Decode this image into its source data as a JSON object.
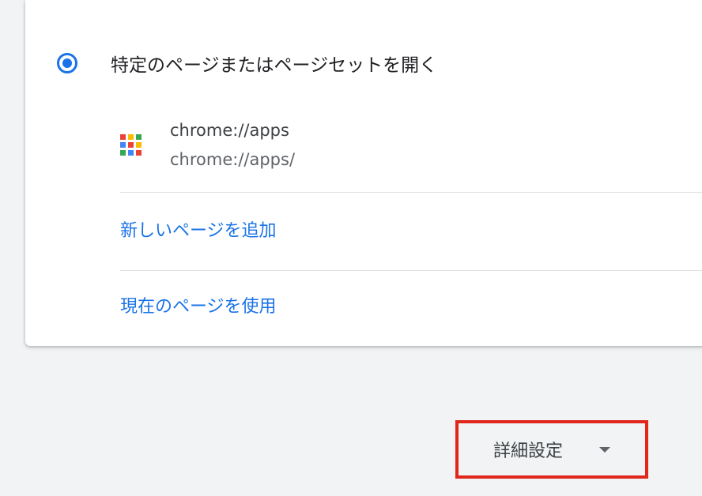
{
  "startup": {
    "radio_label": "特定のページまたはページセットを開く",
    "selected": true
  },
  "site": {
    "icon": "apps-grid-icon",
    "name": "chrome://apps",
    "url": "chrome://apps/"
  },
  "links": {
    "add_page": "新しいページを追加",
    "use_current": "現在のページを使用"
  },
  "advanced": {
    "label": "詳細設定",
    "icon": "caret-down-icon"
  },
  "colors": {
    "accent": "#1a73e8",
    "highlight_border": "#e1261c",
    "apps_icon": [
      "#ea4335",
      "#fbbc04",
      "#34a853",
      "#4285f4",
      "#ea4335",
      "#fbbc04",
      "#34a853",
      "#4285f4",
      "#ea4335"
    ]
  }
}
